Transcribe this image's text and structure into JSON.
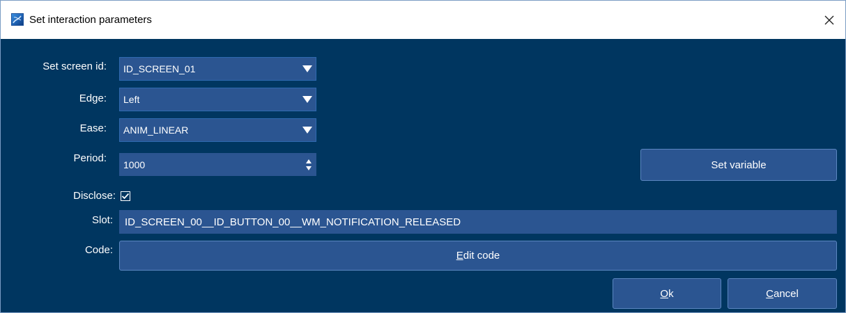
{
  "window": {
    "title": "Set interaction parameters",
    "icons": {
      "app": "app-logo-icon",
      "close": "close-icon"
    }
  },
  "form": {
    "screen_id": {
      "label": "Set screen id:",
      "value": "ID_SCREEN_01"
    },
    "edge": {
      "label": "Edge:",
      "value": "Left"
    },
    "ease": {
      "label": "Ease:",
      "value": "ANIM_LINEAR"
    },
    "period": {
      "label": "Period:",
      "value": "1000"
    },
    "disclose": {
      "label": "Disclose:",
      "checked": true
    },
    "slot": {
      "label": "Slot:",
      "value": "ID_SCREEN_00__ID_BUTTON_00__WM_NOTIFICATION_RELEASED"
    },
    "code": {
      "label": "Code:"
    }
  },
  "buttons": {
    "set_variable": "Set variable",
    "edit_code": {
      "mnemonic": "E",
      "rest": "dit code"
    },
    "ok": {
      "mnemonic": "O",
      "rest": "k"
    },
    "cancel": {
      "mnemonic": "C",
      "rest": "ancel"
    }
  },
  "colors": {
    "background": "#003660",
    "control": "#2b5591",
    "titlebar": "#ffffff",
    "text": "#ffffff"
  }
}
